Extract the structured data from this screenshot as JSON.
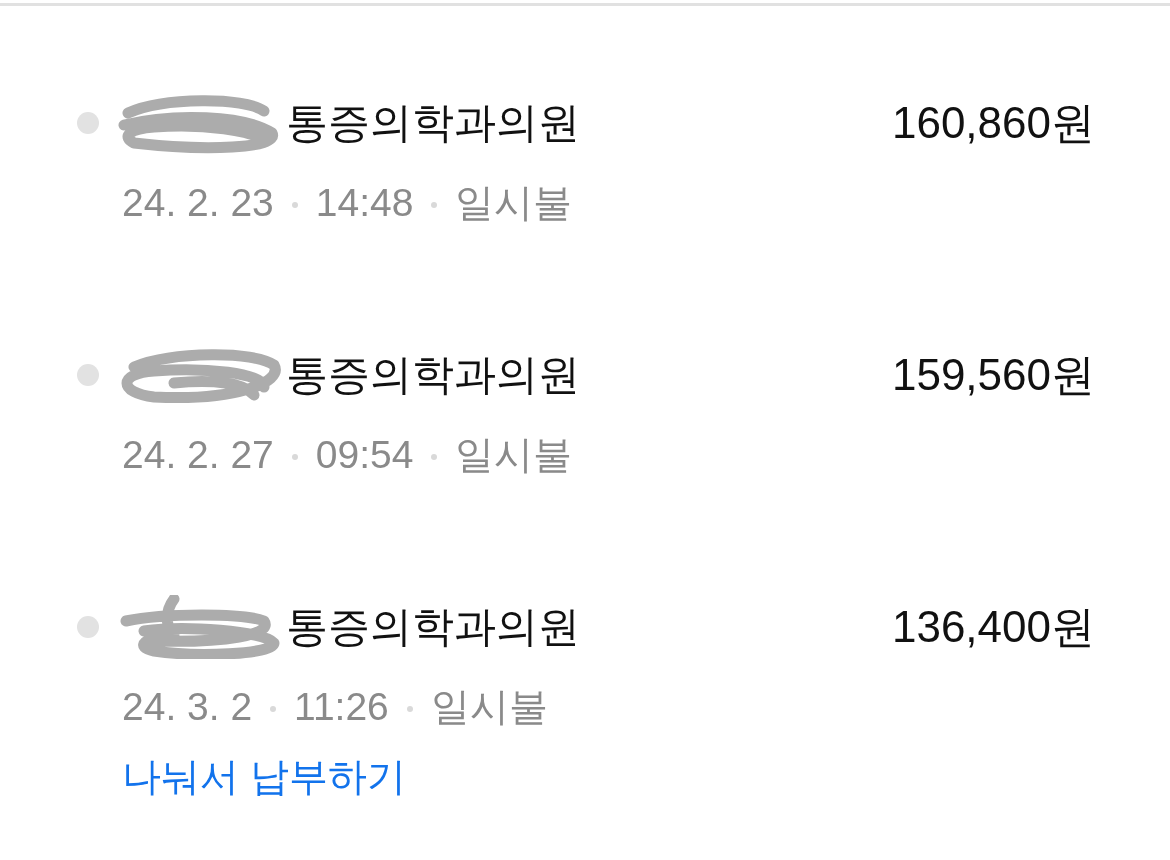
{
  "transactions": [
    {
      "name": "통증의학과의원",
      "redacted": true,
      "amount": "160,860원",
      "date": "24. 2. 23",
      "time": "14:48",
      "payment_type": "일시불"
    },
    {
      "name": "통증의학과의원",
      "redacted": true,
      "amount": "159,560원",
      "date": "24. 2. 27",
      "time": "09:54",
      "payment_type": "일시불"
    },
    {
      "name": "통증의학과의원",
      "redacted": true,
      "amount": "136,400원",
      "date": "24. 3. 2",
      "time": "11:26",
      "payment_type": "일시불",
      "action_link": "나눠서 납부하기"
    }
  ]
}
